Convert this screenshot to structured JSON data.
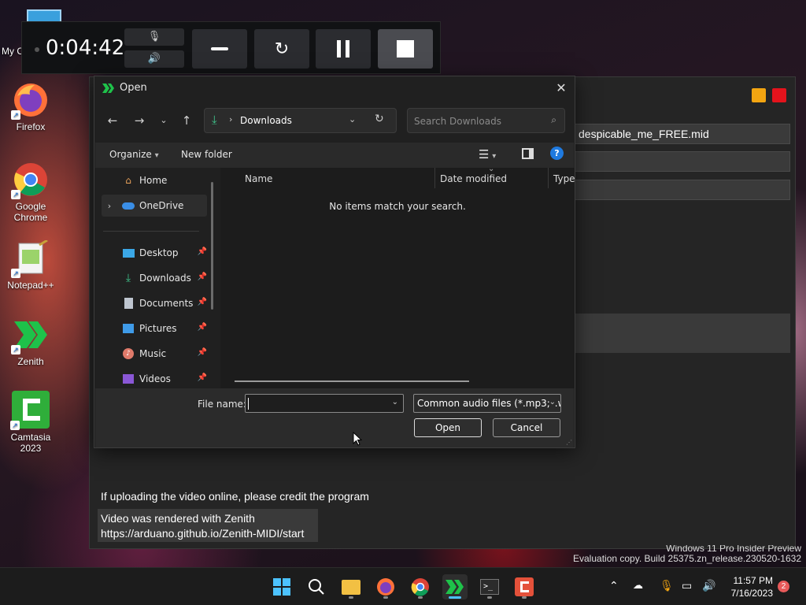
{
  "desktop": {
    "icons": [
      {
        "label": "My C"
      },
      {
        "label": "Firefox"
      },
      {
        "label": "Google Chrome"
      },
      {
        "label": "Notepad++"
      },
      {
        "label": "Zenith"
      },
      {
        "label": "Camtasia 2023"
      }
    ]
  },
  "recorder": {
    "time": "0:04:42"
  },
  "zenith": {
    "file_field": "despicable_me_FREE.mid",
    "credit_line": "If uploading the video online, please credit the program",
    "credit_box_line1": "Video was rendered with Zenith",
    "credit_box_line2": "https://arduano.github.io/Zenith-MIDI/start"
  },
  "dialog": {
    "title": "Open",
    "address": "Downloads",
    "search_placeholder": "Search Downloads",
    "organize": "Organize",
    "new_folder": "New folder",
    "nav": [
      {
        "label": "Home"
      },
      {
        "label": "OneDrive"
      },
      {
        "label": "Desktop"
      },
      {
        "label": "Downloads"
      },
      {
        "label": "Documents"
      },
      {
        "label": "Pictures"
      },
      {
        "label": "Music"
      },
      {
        "label": "Videos"
      }
    ],
    "columns": [
      "Name",
      "Date modified",
      "Type"
    ],
    "empty_message": "No items match your search.",
    "file_name_label": "File name:",
    "file_name_value": "",
    "file_type": "Common audio files (*.mp3;*.w",
    "open_button": "Open",
    "cancel_button": "Cancel"
  },
  "watermark": {
    "line1": "Windows 11 Pro Insider Preview",
    "line2": "Evaluation copy. Build 25375.zn_release.230520-1632"
  },
  "taskbar": {
    "time": "11:57 PM",
    "date": "7/16/2023",
    "notification_count": "2"
  },
  "colors": {
    "accent": "#4cc2ff",
    "zenith_green": "#1ec24a",
    "orange": "#f3a511",
    "red": "#e4131c"
  }
}
